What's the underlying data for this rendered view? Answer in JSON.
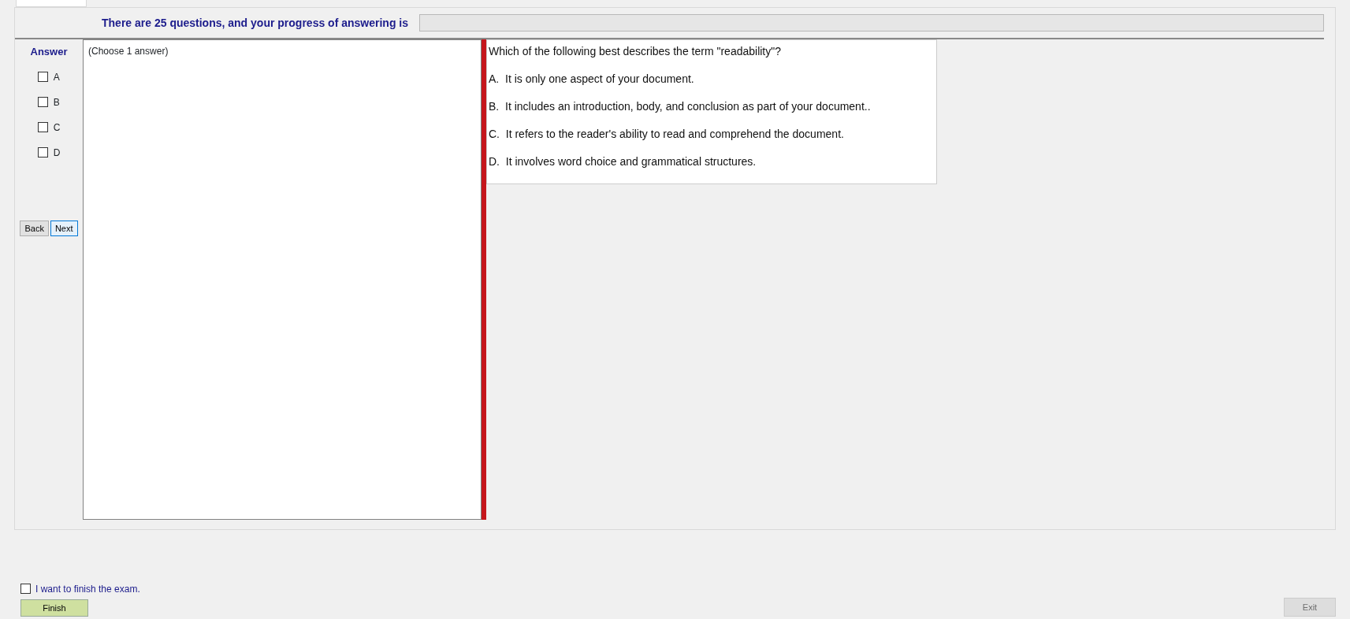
{
  "tabs": [
    {
      "selected": true
    }
  ],
  "progress": {
    "label": "There are 25 questions, and your progress of answering is",
    "level": 0
  },
  "answer": {
    "title": "Answer",
    "options": [
      {
        "label": "A",
        "checked": false
      },
      {
        "label": "B",
        "checked": false
      },
      {
        "label": "C",
        "checked": false
      },
      {
        "label": "D",
        "checked": false
      }
    ]
  },
  "nav_buttons": [
    {
      "label": "Back",
      "focused": false
    },
    {
      "label": "Next",
      "focused": true
    }
  ],
  "answer_box": {
    "text": "(Choose 1 answer)"
  },
  "question": {
    "text": "Which of the following best describes the term \"readability\"?",
    "choices": [
      "A.  It is only one aspect of your document.",
      "B.  It includes an introduction, body, and conclusion as part of your document..",
      "C.  It refers to the reader's ability to read and comprehend the document.",
      "D.  It involves word choice and grammatical structures."
    ]
  },
  "finish": {
    "label": "I want to finish the exam.",
    "checked": false,
    "button": "Finish"
  },
  "exit_button": {
    "label": "Exit",
    "disabled": true
  }
}
